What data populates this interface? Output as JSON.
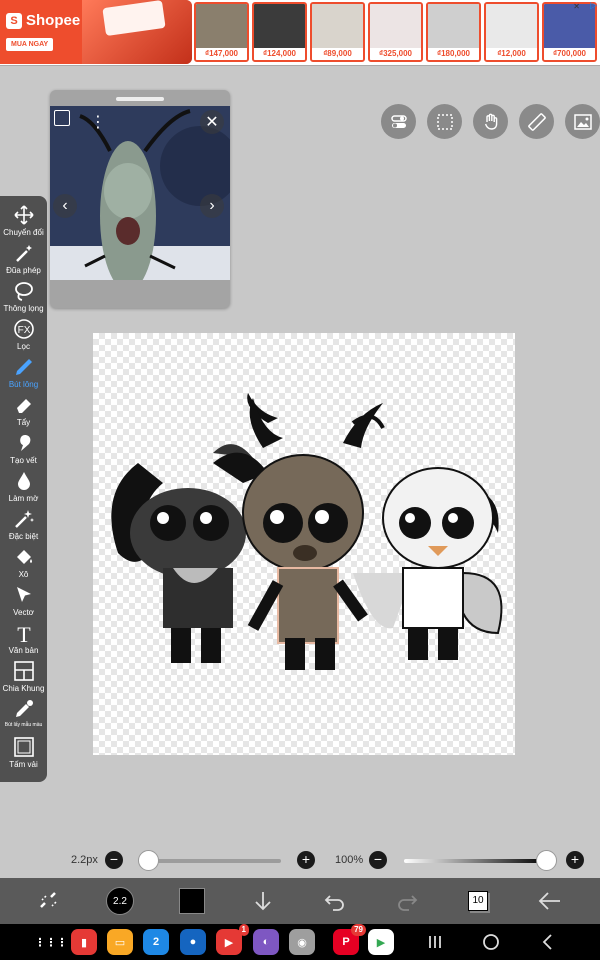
{
  "ad": {
    "brand": "Shopee",
    "cta": "MUA NGAY",
    "products": [
      {
        "price": "₫147,000",
        "color": "#8a7f6d"
      },
      {
        "price": "₫124,000",
        "color": "#3b3b3b"
      },
      {
        "price": "₫89,000",
        "color": "#d9d4cc"
      },
      {
        "price": "₫325,000",
        "color": "#ece4e4"
      },
      {
        "price": "₫180,000",
        "color": "#cfcfcf"
      },
      {
        "price": "₫12,000",
        "color": "#e9e9e9"
      },
      {
        "price": "₫700,000",
        "color": "#4a5ba8"
      }
    ],
    "close": "✕",
    "info": "▷"
  },
  "top_tools": [
    {
      "icon": "toggle-icon",
      "name": "toggle-button"
    },
    {
      "icon": "selection-icon",
      "name": "selection-button"
    },
    {
      "icon": "hand-icon",
      "name": "hand-button"
    },
    {
      "icon": "ruler-icon",
      "name": "ruler-button"
    },
    {
      "icon": "image-icon",
      "name": "image-button"
    }
  ],
  "toolbar": {
    "transform": "Chuyển đổi",
    "magic": "Đũa phép",
    "lasso": "Thông lọng",
    "filter": "Lọc",
    "brush": "Bút lông",
    "eraser": "Tẩy",
    "smudge": "Tạo vết",
    "blur": "Làm mờ",
    "special": "Đặc biệt",
    "fill": "Xô",
    "vector": "Vectơ",
    "text": "Văn bản",
    "frame": "Chia Khung",
    "eyedropper": "Bút lấy mẫu màu",
    "canvas": "Tấm vải"
  },
  "sliders": {
    "size_label": "2.2px",
    "size_value": 2.2,
    "opacity_label": "100%",
    "opacity_value": 100
  },
  "appbar": {
    "brush_size": "2.2",
    "color": "#000000",
    "layer_count": "10"
  },
  "navbar": {
    "apps": [
      {
        "name": "app-grid",
        "color": "transparent",
        "glyph": "⋮⋮⋮"
      },
      {
        "name": "red-app",
        "color": "#e53935",
        "glyph": "▮"
      },
      {
        "name": "folder-app",
        "color": "#f9a825",
        "glyph": "▭"
      },
      {
        "name": "calendar-app",
        "color": "#1e88e5",
        "glyph": "2"
      },
      {
        "name": "messages-app",
        "color": "#1565c0",
        "glyph": "●"
      },
      {
        "name": "youtube-app",
        "color": "#e53935",
        "glyph": "▶",
        "badge": "1"
      },
      {
        "name": "browser-app",
        "color": "#7e57c2",
        "glyph": "◐"
      },
      {
        "name": "camera-app",
        "color": "#9e9e9e",
        "glyph": "◉"
      },
      {
        "name": "pinterest-app",
        "color": "#e60023",
        "glyph": "P",
        "badge": "79"
      },
      {
        "name": "play-store-app",
        "color": "#ffffff",
        "glyph": "▶"
      }
    ]
  }
}
